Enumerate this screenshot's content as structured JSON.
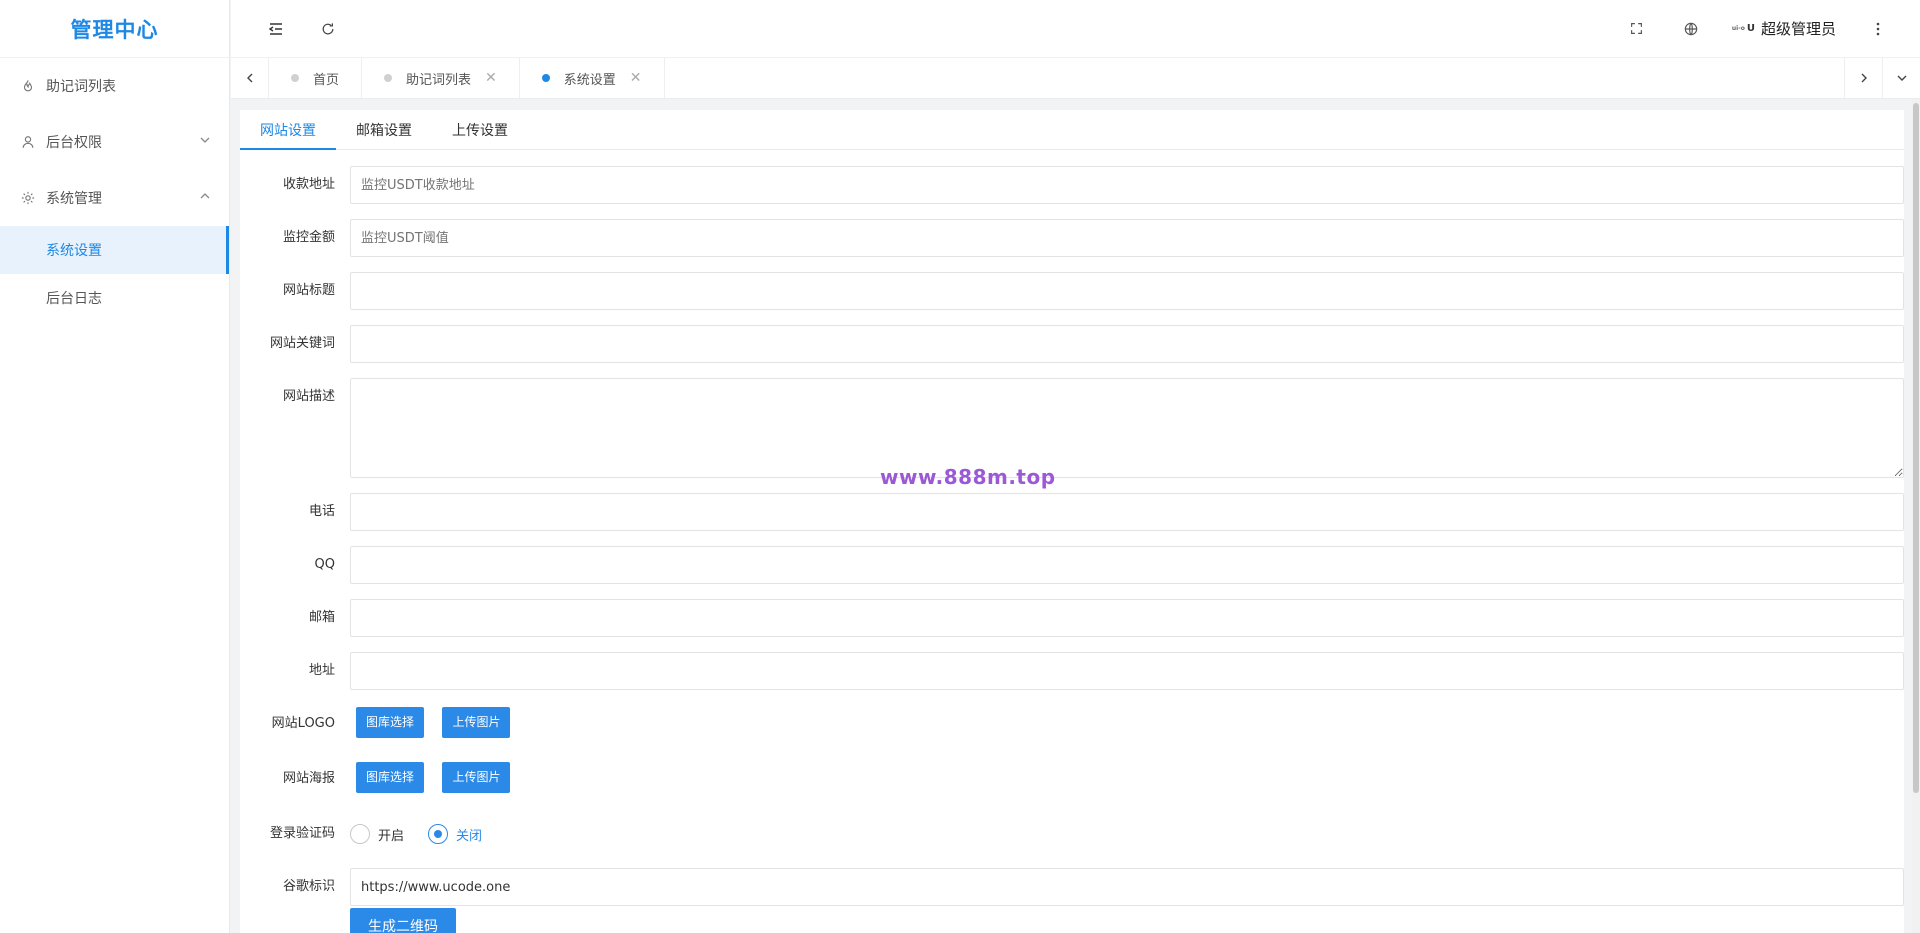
{
  "app": {
    "title": "管理中心"
  },
  "sidebar": {
    "items": [
      {
        "label": "助记词列表",
        "icon": "fire-icon"
      },
      {
        "label": "后台权限",
        "icon": "user-icon",
        "arrow": "chevron-down-icon"
      },
      {
        "label": "系统管理",
        "icon": "gear-icon",
        "arrow": "chevron-up-icon"
      }
    ],
    "subitems": [
      {
        "label": "系统设置",
        "active": true
      },
      {
        "label": "后台日志",
        "active": false
      }
    ]
  },
  "header": {
    "user_name": "超级管理员",
    "avatar_text": "U",
    "avatar_small": "ui-o"
  },
  "tabs": [
    {
      "label": "首页",
      "active": false,
      "closable": false
    },
    {
      "label": "助记词列表",
      "active": false,
      "closable": true
    },
    {
      "label": "系统设置",
      "active": true,
      "closable": true
    }
  ],
  "settings_tabs": [
    {
      "label": "网站设置",
      "active": true
    },
    {
      "label": "邮箱设置",
      "active": false
    },
    {
      "label": "上传设置",
      "active": false
    }
  ],
  "form": {
    "fields": [
      {
        "label": "收款地址",
        "value": "",
        "placeholder": "监控USDT收款地址"
      },
      {
        "label": "监控金额",
        "value": "",
        "placeholder": "监控USDT阈值"
      },
      {
        "label": "网站标题",
        "value": "",
        "placeholder": ""
      },
      {
        "label": "网站关键词",
        "value": "",
        "placeholder": ""
      },
      {
        "label": "网站描述",
        "value": "",
        "placeholder": ""
      },
      {
        "label": "电话",
        "value": "",
        "placeholder": ""
      },
      {
        "label": "QQ",
        "value": "",
        "placeholder": ""
      },
      {
        "label": "邮箱",
        "value": "",
        "placeholder": ""
      },
      {
        "label": "地址",
        "value": "",
        "placeholder": ""
      }
    ],
    "logo": {
      "label": "网站LOGO",
      "btn_gallery": "图库选择",
      "btn_upload": "上传图片"
    },
    "poster": {
      "label": "网站海报",
      "btn_gallery": "图库选择",
      "btn_upload": "上传图片"
    },
    "captcha": {
      "label": "登录验证码",
      "option_on": "开启",
      "option_off": "关闭",
      "selected": "关闭"
    },
    "google": {
      "label": "谷歌标识",
      "value": "https://www.ucode.one"
    },
    "qr_button": "生成二维码"
  },
  "watermark": "www.888m.top",
  "colors": {
    "accent": "#1e88e5",
    "button": "#2b8ae8",
    "watermark": "#9b59d6"
  }
}
